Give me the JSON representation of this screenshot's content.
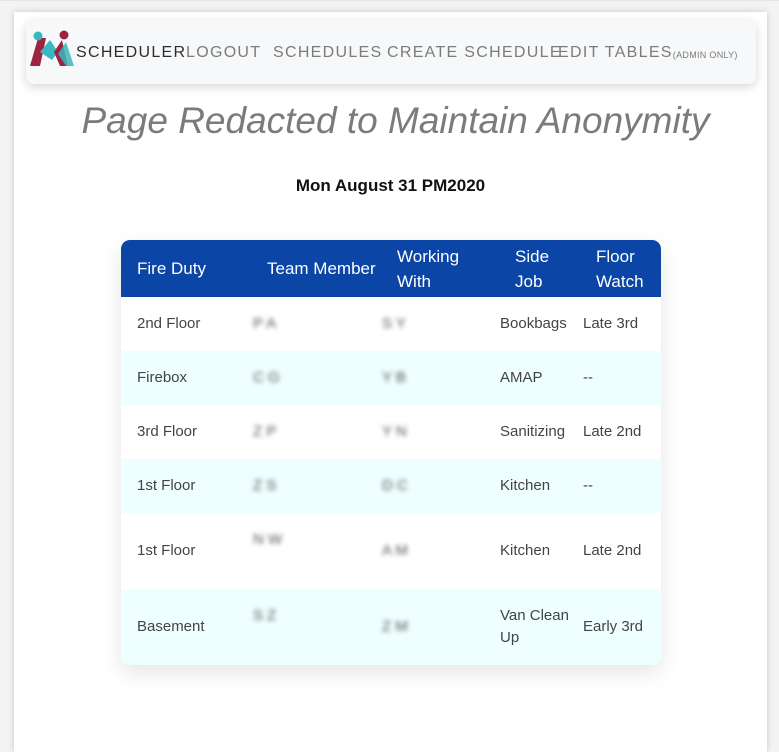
{
  "nav": {
    "brand": "SCHEDULER",
    "logout": "LOGOUT",
    "schedules": "SCHEDULES",
    "create": "CREATE SCHEDULE",
    "edit": "EDIT TABLES",
    "edit_note": "(ADMIN ONLY)"
  },
  "title": "Page Redacted to Maintain Anonymity",
  "date": "Mon August 31 PM2020",
  "table": {
    "headers": [
      "Fire Duty",
      "Team Member",
      "Working With",
      "Side Job",
      "Floor Watch"
    ],
    "rows": [
      {
        "duty": "2nd Floor",
        "member": "P    A",
        "with": "S Y",
        "job": "Bookbags",
        "watch": "Late 3rd"
      },
      {
        "duty": "Firebox",
        "member": "C    G",
        "with": "Y B",
        "job": "AMAP",
        "watch": "--"
      },
      {
        "duty": "3rd Floor",
        "member": "Z  P",
        "with": "Y N",
        "job": "Sanitizing",
        "watch": "Late 2nd"
      },
      {
        "duty": "1st Floor",
        "member": "Z  S",
        "with": "D C",
        "job": "Kitchen",
        "watch": "--"
      },
      {
        "duty": "1st Floor",
        "member": "N W",
        "with": "A M",
        "job": "Kitchen",
        "watch": "Late 2nd"
      },
      {
        "duty": "Basement",
        "member": "S Z",
        "with": "Z M",
        "job": "Van Clean Up",
        "watch": "Early 3rd"
      }
    ]
  },
  "colors": {
    "header_bg": "#0b46a6",
    "alt_row": "#effefe",
    "logo_teal": "#39b8c0",
    "logo_maroon": "#9c2440"
  }
}
